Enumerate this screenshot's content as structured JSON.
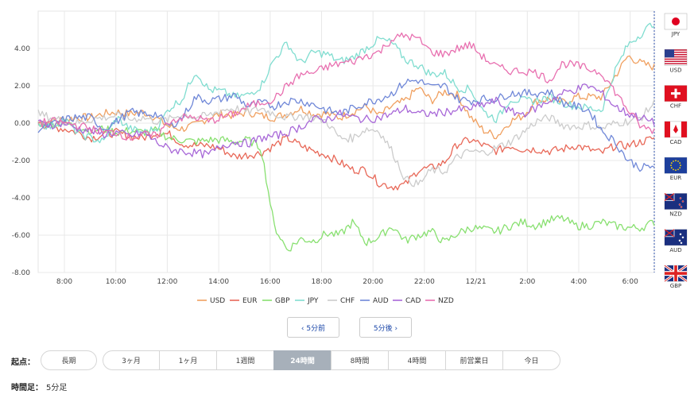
{
  "chart_data": {
    "type": "line",
    "x_ticks": [
      "8:00",
      "10:00",
      "12:00",
      "14:00",
      "16:00",
      "18:00",
      "20:00",
      "22:00",
      "12/21",
      "2:00",
      "4:00",
      "6:00"
    ],
    "y_ticks": [
      "4.00",
      "2.00",
      "0.00",
      "-2.00",
      "-4.00",
      "-6.00",
      "-8.00"
    ],
    "ylim": [
      -8,
      6
    ],
    "grid": true,
    "legend_position": "bottom",
    "series": [
      {
        "name": "USD",
        "color": "#f0a060",
        "values": [
          0,
          0.1,
          0.2,
          0.3,
          0.3,
          0.5,
          0.6,
          0.5,
          0.6,
          0.3,
          -0.2,
          -0.3,
          -0.1,
          0.3,
          0.5,
          0.4,
          0.6,
          0.4,
          0.3,
          0.5,
          0.8,
          0.5,
          0.5,
          0.3,
          0.6,
          0.9,
          0.4,
          0.9,
          1.2,
          1.9,
          1.2,
          1.7,
          1.5,
          0.3,
          -0.4,
          -0.7,
          0.1,
          0.4,
          1.2,
          1.3,
          1.1,
          1.4,
          1.4,
          1.4,
          2.5,
          3.6,
          3.2,
          3.0
        ]
      },
      {
        "name": "EUR",
        "color": "#e86858",
        "values": [
          0,
          -0.2,
          -0.3,
          -0.5,
          -0.8,
          -0.6,
          -0.5,
          -0.7,
          -0.8,
          -0.5,
          -0.6,
          -1.1,
          -1.2,
          -1.2,
          -1.4,
          -1.8,
          -1.7,
          -1.6,
          -1.2,
          -0.8,
          -1.2,
          -1.5,
          -1.7,
          -2.1,
          -2.5,
          -2.5,
          -3.2,
          -3.4,
          -3.3,
          -2.5,
          -2.4,
          -2.1,
          -1.1,
          -0.9,
          -1.2,
          -1.5,
          -1.2,
          -1.4,
          -1.4,
          -1.5,
          -1.4,
          -1.2,
          -1.4,
          -1.6,
          -1.2,
          -1.2,
          -1.0,
          -0.8
        ]
      },
      {
        "name": "GBP",
        "color": "#88e070",
        "values": [
          0,
          0,
          0,
          -0.2,
          -0.4,
          -0.3,
          -0.5,
          -0.4,
          -0.5,
          -0.4,
          -0.8,
          -0.9,
          -1.0,
          -0.9,
          -0.9,
          -1.0,
          -0.9,
          -1.3,
          -5.5,
          -6.8,
          -6.2,
          -6.3,
          -5.9,
          -6.0,
          -5.3,
          -6.4,
          -6.1,
          -5.5,
          -6.3,
          -6.0,
          -5.8,
          -6.4,
          -5.9,
          -5.6,
          -5.7,
          -5.8,
          -5.5,
          -5.3,
          -5.5,
          -5.2,
          -5.1,
          -5.5,
          -5.5,
          -5.3,
          -5.5,
          -5.6,
          -5.6,
          -5.3
        ]
      },
      {
        "name": "JPY",
        "color": "#80ddd0",
        "values": [
          0,
          -0.2,
          0.2,
          -0.5,
          -0.8,
          -1.0,
          0.3,
          -0.3,
          -0.5,
          -0.3,
          0.8,
          1.3,
          2.8,
          1.8,
          1.7,
          1.4,
          1.5,
          2.0,
          3.4,
          4.3,
          3.2,
          3.8,
          3.7,
          3.3,
          3.5,
          4.0,
          4.5,
          4.3,
          3.4,
          3.1,
          2.6,
          2.7,
          1.9,
          1.8,
          0.6,
          0.2,
          1.3,
          1.2,
          1.2,
          1.4,
          1.1,
          0.9,
          0.8,
          0.7,
          2.8,
          4.2,
          4.8,
          5.4
        ]
      },
      {
        "name": "CHF",
        "color": "#cccccc",
        "values": [
          0.5,
          0.3,
          0.1,
          0,
          0.2,
          0.3,
          0.4,
          0.2,
          0.3,
          0.1,
          0.2,
          0.5,
          0.3,
          0.4,
          0.7,
          0.8,
          0.6,
          0.8,
          0.5,
          0.3,
          0.4,
          0.3,
          0.1,
          -0.8,
          -0.8,
          -0.3,
          -0.4,
          -1.5,
          -3.0,
          -3.3,
          -2.5,
          -2.6,
          -1.8,
          -1.5,
          -1.6,
          -1.3,
          -1.0,
          -0.5,
          0.1,
          0.3,
          -0.1,
          -0.2,
          -0.1,
          -0.3,
          0,
          0.1,
          0.3,
          1.1
        ]
      },
      {
        "name": "AUD",
        "color": "#7088d8",
        "values": [
          -0.3,
          -0.1,
          0.2,
          0.3,
          0.3,
          -0.3,
          0.1,
          0.6,
          0.5,
          0.5,
          -0.2,
          0.3,
          1.4,
          1.2,
          1.3,
          1.5,
          0.9,
          1.1,
          0.9,
          1.2,
          1.2,
          1.0,
          0.7,
          0.5,
          0.8,
          1.1,
          1.3,
          1.6,
          2.2,
          2.3,
          1.9,
          2.0,
          1.3,
          1.2,
          1.3,
          1.3,
          1.6,
          1.6,
          1.6,
          1.7,
          1.1,
          0.9,
          0.7,
          -0.4,
          -1.0,
          -2.0,
          -2.4,
          -2.3
        ]
      },
      {
        "name": "CAD",
        "color": "#a868d8",
        "values": [
          0,
          -0.1,
          0,
          -0.3,
          -0.4,
          -0.6,
          -0.5,
          -0.7,
          -0.5,
          -1.0,
          -1.4,
          -1.5,
          -1.6,
          -1.7,
          -1.2,
          -1.0,
          -1.1,
          -0.8,
          -0.7,
          -0.5,
          -0.2,
          0.2,
          0.2,
          0.5,
          0.3,
          0.2,
          0.3,
          0.5,
          0.8,
          0.5,
          0.5,
          0.6,
          0.7,
          0.8,
          1.0,
          1.2,
          0.6,
          0.5,
          0.8,
          1.2,
          1.6,
          1.8,
          2.0,
          1.6,
          0.9,
          0.5,
          0.3,
          0
        ]
      },
      {
        "name": "NZD",
        "color": "#e870b0",
        "values": [
          0,
          0.1,
          0,
          -0.1,
          -0.3,
          -0.5,
          -0.5,
          -0.8,
          -0.6,
          -0.7,
          0.1,
          0.3,
          0.3,
          0.1,
          0.3,
          0.5,
          0.9,
          1.1,
          1.3,
          2.0,
          2.6,
          2.7,
          3.0,
          3.2,
          3.3,
          3.6,
          3.8,
          4.5,
          4.7,
          4.5,
          3.8,
          3.7,
          4.0,
          4.2,
          3.5,
          3.0,
          2.8,
          2.8,
          2.7,
          2.3,
          3.2,
          3.1,
          2.9,
          2.7,
          1.7,
          0.7,
          -0.2,
          -0.4
        ]
      }
    ],
    "flags": [
      "JPY",
      "USD",
      "CHF",
      "CAD",
      "EUR",
      "NZD",
      "AUD",
      "GBP"
    ]
  },
  "nav": {
    "prev": "‹ 5分前",
    "next": "5分後 ›"
  },
  "start_label": "起点：",
  "periods": [
    "長期",
    "3ヶ月",
    "1ヶ月",
    "1週間",
    "24時間",
    "8時間",
    "4時間",
    "前営業日",
    "今日"
  ],
  "active_period": "24時間",
  "timeframe_label": "時間足：",
  "timeframe_value": "5分足"
}
